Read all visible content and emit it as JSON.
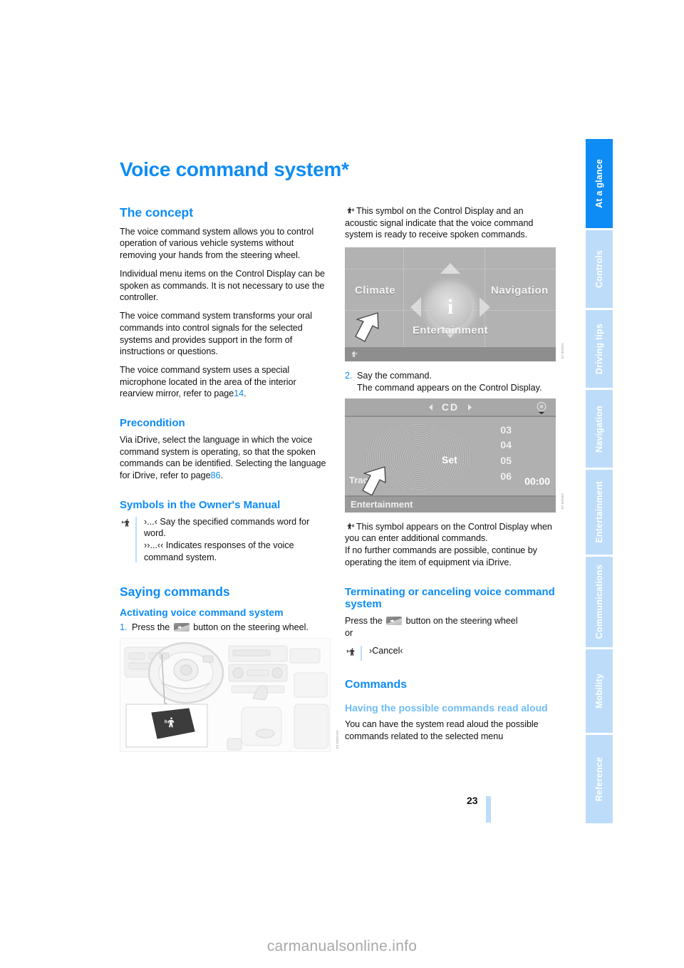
{
  "document": {
    "title": "Voice command system*",
    "page_number": "23",
    "watermark": "carmanualsonline.info"
  },
  "tab_rail": {
    "active": "At a glance",
    "items": [
      {
        "label": "At a glance",
        "active": true
      },
      {
        "label": "Controls",
        "active": false
      },
      {
        "label": "Driving tips",
        "active": false
      },
      {
        "label": "Navigation",
        "active": false
      },
      {
        "label": "Entertainment",
        "active": false
      },
      {
        "label": "Communications",
        "active": false
      },
      {
        "label": "Mobility",
        "active": false
      },
      {
        "label": "Reference",
        "active": false
      }
    ]
  },
  "left_column": {
    "concept_heading": "The concept",
    "concept_p1": "The voice command system allows you to control operation of various vehicle systems without removing your hands from the steering wheel.",
    "concept_p2": "Individual menu items on the Control Display can be spoken as commands. It is not necessary to use the controller.",
    "concept_p3": "The voice command system transforms your oral commands into control signals for the selected systems and provides support in the form of instructions or questions.",
    "concept_p4_before": "The voice command system uses a special microphone located in the area of the interior rearview mirror, refer to page",
    "concept_p4_ref": "14",
    "concept_p4_after": ".",
    "precondition_heading": "Precondition",
    "precondition_p1_before": "Via iDrive, select the language in which the voice command system is operating, so that the spoken commands can be identified. Selecting the language for iDrive, refer to page",
    "precondition_p1_ref": "86",
    "precondition_p1_after": ".",
    "symbols_heading": "Symbols in the Owner's Manual",
    "symbol_note_line1": "›...‹ Say the specified commands word for word.",
    "symbol_note_line2": "››...‹‹ Indicates responses of the voice command system.",
    "saying_heading": "Saying commands",
    "activating_heading": "Activating voice command system",
    "step1_num": "1.",
    "step1_before": "Press the",
    "step1_after": "button on the steering wheel."
  },
  "right_column": {
    "ready_note_text": "This symbol on the Control Display and an acoustic signal indicate that the voice command system is ready to receive spoken commands.",
    "idrive_figure": {
      "name": "idrive-main-menu",
      "menu_items": [
        "Climate",
        "Navigation",
        "Entertainment"
      ],
      "center_icon": "i",
      "code": "VNS05.23"
    },
    "step2_num": "2.",
    "step2_text": "Say the command.",
    "step2_text2": "The command appears on the Control Display.",
    "cd_figure": {
      "name": "cd-playback-screen",
      "source_label": "CD",
      "center_label": "Set",
      "track_numbers": [
        "03",
        "04",
        "05",
        "06"
      ],
      "track_word": "Track",
      "time": "00:00",
      "status_label": "Entertainment",
      "code": "UBS05.23"
    },
    "additional_note_line1": "This symbol appears on the Control Display when you can enter additional commands.",
    "additional_note_line2": "If no further commands are possible, continue by operating the item of equipment via iDrive.",
    "terminating_heading": "Terminating or canceling voice command system",
    "terminating_before": "Press the",
    "terminating_after": "button on the steering wheel",
    "terminating_or": "or",
    "cancel_command": "›Cancel‹",
    "commands_heading": "Commands",
    "read_aloud_heading": "Having the possible commands read aloud",
    "read_aloud_p1": "You can have the system read aloud the possible commands related to the selected menu"
  },
  "figures": {
    "interior_figure": {
      "name": "steering-wheel-voice-button-photo",
      "code": "MA2303.23"
    }
  },
  "colors": {
    "accent_blue": "#0d8cf5",
    "light_blue": "#bcdcfa",
    "mid_blue": "#6ebcf7",
    "text": "#111111",
    "watermark_gray": "#a8a8a8"
  },
  "icons": {
    "speak_ready": "voice-ready-icon",
    "speak_additional": "voice-additional-icon",
    "steering_button": "steering-wheel-voice-button-icon"
  }
}
